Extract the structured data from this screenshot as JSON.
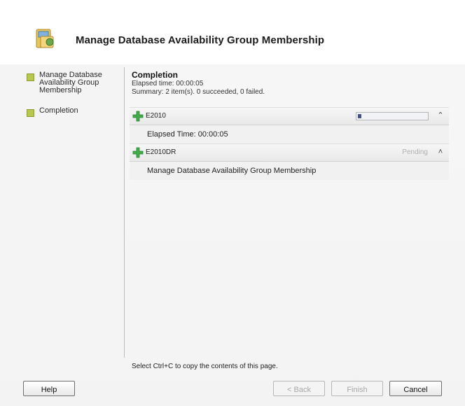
{
  "header": {
    "title": "Manage Database Availability Group Membership",
    "icon": "exchange-wizard-icon"
  },
  "sidebar": {
    "steps": [
      {
        "label": "Manage Database Availability Group Membership"
      },
      {
        "label": "Completion"
      }
    ],
    "step_color": "#b7c84d"
  },
  "content": {
    "title": "Completion",
    "elapsed": "Elapsed time: 00:00:05",
    "summary": "Summary: 2 item(s). 0 succeeded, 0 failed."
  },
  "items": [
    {
      "name": "E2010",
      "detail": "Elapsed Time: 00:00:05",
      "progress": 0.05,
      "status": ""
    },
    {
      "name": "E2010DR",
      "detail": "Manage Database Availability Group Membership",
      "status": "Pending"
    }
  ],
  "footer": {
    "hint": "Select Ctrl+C to copy the contents of this page.",
    "help_label": "Help",
    "back_label": "< Back",
    "finish_label": "Finish",
    "cancel_label": "Cancel"
  },
  "colors": {
    "progress_fill": "#44508a",
    "plus_green": "#3fae49"
  }
}
